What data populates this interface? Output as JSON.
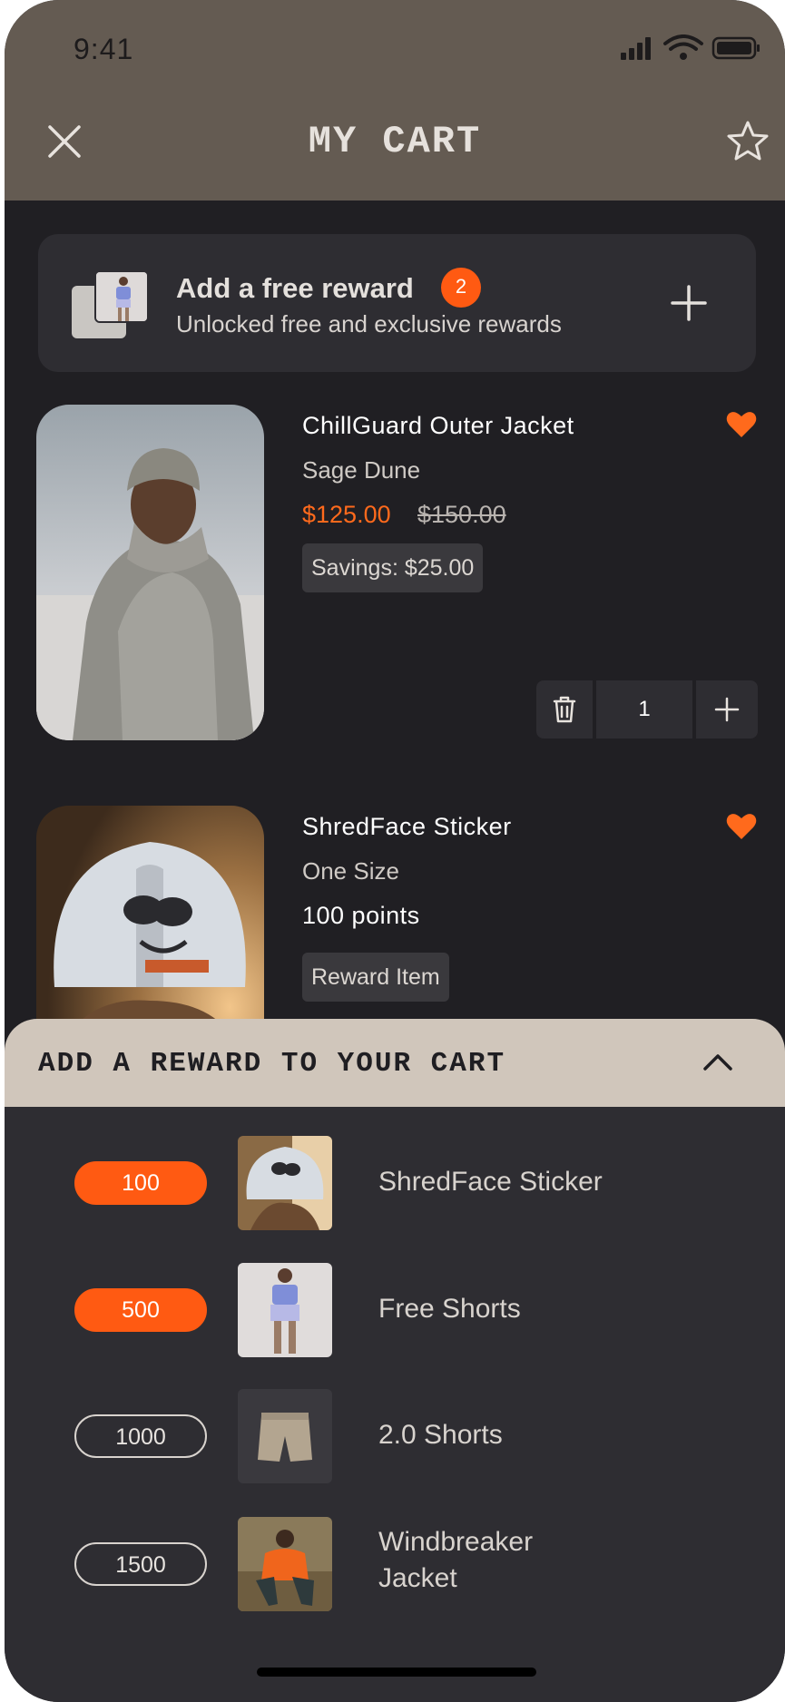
{
  "status_bar": {
    "time": "9:41"
  },
  "header": {
    "title": "MY CART"
  },
  "reward_banner": {
    "title": "Add a free reward",
    "badge_count": "2",
    "subtitle": "Unlocked free and exclusive rewards"
  },
  "cart_items": [
    {
      "name": "ChillGuard Outer Jacket",
      "variant": "Sage Dune",
      "price": "$125.00",
      "original_price": "$150.00",
      "tag": "Savings: $25.00",
      "quantity": "1",
      "favorited": true
    },
    {
      "name": "ShredFace Sticker",
      "variant": "One Size",
      "points": "100 points",
      "tag": "Reward Item",
      "favorited": true
    }
  ],
  "rewards_sheet": {
    "title": "ADD A REWARD TO YOUR CART",
    "items": [
      {
        "points": "100",
        "name": "ShredFace Sticker",
        "unlocked": true
      },
      {
        "points": "500",
        "name": "Free Shorts",
        "unlocked": true
      },
      {
        "points": "1000",
        "name": "2.0 Shorts",
        "unlocked": false
      },
      {
        "points": "1500",
        "name": "Windbreaker Jacket",
        "unlocked": false
      }
    ]
  },
  "colors": {
    "header_bg": "#645b52",
    "page_bg": "#201f23",
    "accent": "#ff5a12",
    "sheet_header_bg": "#d0c6bb"
  }
}
